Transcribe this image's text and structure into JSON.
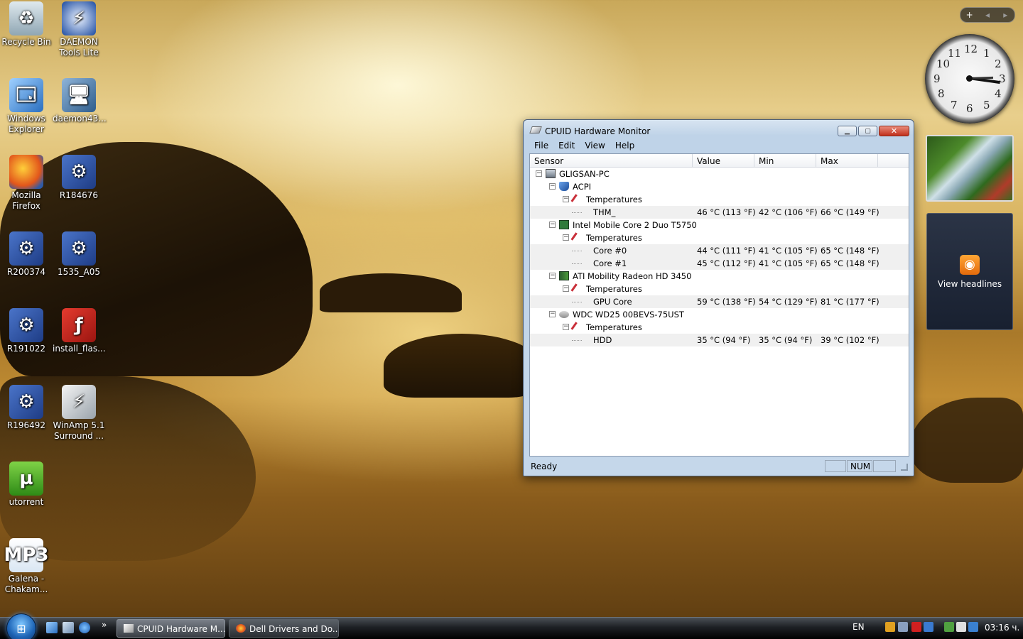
{
  "desktop": {
    "icons": [
      {
        "label": "Recycle Bin",
        "glyph": "♻",
        "icon": "recycle-bin-icon"
      },
      {
        "label": "DAEMON Tools Lite",
        "glyph": "⚡",
        "icon": "daemon-tools-icon"
      },
      {
        "label": "Windows Explorer",
        "glyph": "🗔",
        "icon": "windows-explorer-icon"
      },
      {
        "label": "daemon43...",
        "glyph": "🖥",
        "icon": "installer-icon"
      },
      {
        "label": "Mozilla Firefox",
        "glyph": "",
        "icon": "firefox-icon"
      },
      {
        "label": "R184676",
        "glyph": "⚙",
        "icon": "setup-icon"
      },
      {
        "label": "R200374",
        "glyph": "⚙",
        "icon": "setup-icon"
      },
      {
        "label": "1535_A05",
        "glyph": "⚙",
        "icon": "setup-icon"
      },
      {
        "label": "R191022",
        "glyph": "⚙",
        "icon": "setup-icon"
      },
      {
        "label": "install_flas...",
        "glyph": "ƒ",
        "icon": "flash-installer-icon"
      },
      {
        "label": "R196492",
        "glyph": "⚙",
        "icon": "setup-icon"
      },
      {
        "label": "WinAmp 5.1 Surround ...",
        "glyph": "⚡",
        "icon": "winamp-installer-icon"
      },
      {
        "label": "utorrent",
        "glyph": "µ",
        "icon": "utorrent-icon"
      },
      {
        "label": "Galena - Chakam...",
        "glyph": "MP3",
        "icon": "mp3-file-icon"
      }
    ]
  },
  "gadgets": {
    "toolbar": {
      "add": "+",
      "prev": "◂",
      "next": "▸"
    },
    "clock": {
      "numbers": [
        "12",
        "1",
        "2",
        "3",
        "4",
        "5",
        "6",
        "7",
        "8",
        "9",
        "10",
        "11"
      ]
    },
    "feed": {
      "label": "View headlines",
      "icon": "rss-icon"
    }
  },
  "window": {
    "title": "CPUID Hardware Monitor",
    "controls": {
      "minimize": "▁",
      "maximize": "▢",
      "close": "✕"
    },
    "menu": [
      "File",
      "Edit",
      "View",
      "Help"
    ],
    "columns": [
      "Sensor",
      "Value",
      "Min",
      "Max"
    ],
    "rows": [
      {
        "name": "GLIGSAN-PC",
        "level": 0,
        "icon": "computer-icon",
        "toggle": "−"
      },
      {
        "name": "ACPI",
        "level": 1,
        "icon": "acpi-icon",
        "toggle": "−"
      },
      {
        "name": "Temperatures",
        "level": 2,
        "icon": "thermometer-icon",
        "toggle": "−"
      },
      {
        "name": "THM_",
        "level": 3,
        "value": "46 °C  (113 °F)",
        "min": "42 °C  (106 °F)",
        "max": "66 °C  (149 °F)"
      },
      {
        "name": "Intel Mobile Core 2 Duo T5750",
        "level": 1,
        "icon": "cpu-icon",
        "toggle": "−"
      },
      {
        "name": "Temperatures",
        "level": 2,
        "icon": "thermometer-icon",
        "toggle": "−"
      },
      {
        "name": "Core #0",
        "level": 3,
        "value": "44 °C  (111 °F)",
        "min": "41 °C  (105 °F)",
        "max": "65 °C  (148 °F)"
      },
      {
        "name": "Core #1",
        "level": 3,
        "value": "45 °C  (112 °F)",
        "min": "41 °C  (105 °F)",
        "max": "65 °C  (148 °F)"
      },
      {
        "name": "ATI Mobility Radeon HD 3450",
        "level": 1,
        "icon": "gpu-icon",
        "toggle": "−"
      },
      {
        "name": "Temperatures",
        "level": 2,
        "icon": "thermometer-icon",
        "toggle": "−"
      },
      {
        "name": "GPU Core",
        "level": 3,
        "value": "59 °C  (138 °F)",
        "min": "54 °C  (129 °F)",
        "max": "81 °C  (177 °F)"
      },
      {
        "name": "WDC WD25 00BEVS-75UST",
        "level": 1,
        "icon": "hdd-icon",
        "toggle": "−"
      },
      {
        "name": "Temperatures",
        "level": 2,
        "icon": "thermometer-icon",
        "toggle": "−"
      },
      {
        "name": "HDD",
        "level": 3,
        "value": "35 °C  (94 °F)",
        "min": "35 °C  (94 °F)",
        "max": "39 °C  (102 °F)"
      }
    ],
    "status": {
      "text": "Ready",
      "num": "NUM"
    }
  },
  "taskbar": {
    "start_glyph": "⊞",
    "quicklaunch_more": "»",
    "tasks": [
      {
        "label": "CPUID Hardware M...",
        "active": true
      },
      {
        "label": "Dell Drivers and Do...",
        "active": false
      }
    ],
    "lang": "EN",
    "time": "03:16 ч.",
    "tray_colors": [
      "#e0a020",
      "#8aa0c0",
      "#d02020",
      "#3a7ad0",
      "#50a040",
      "#e0e0e0",
      "#3a80d0",
      "#7fc060",
      "#cccccc"
    ]
  }
}
